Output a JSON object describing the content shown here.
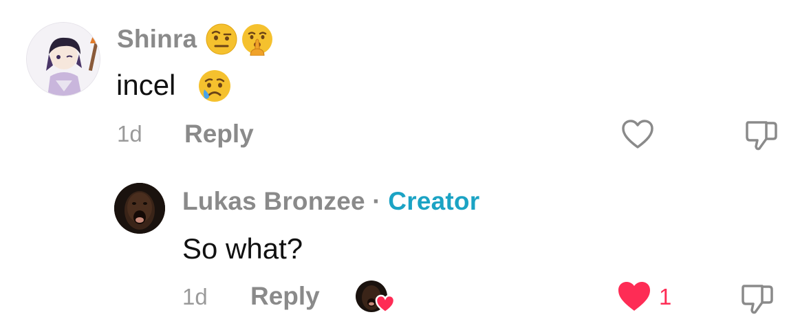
{
  "comment": {
    "username": "Shinra",
    "text": "incel",
    "time": "1d",
    "reply_label": "Reply",
    "emojis": [
      "raised-eyebrow-emoji",
      "shushing-face-emoji",
      "crying-face-emoji"
    ]
  },
  "reply": {
    "username": "Lukas Bronzee",
    "separator": "·",
    "badge": "Creator",
    "text": "So what?",
    "time": "1d",
    "reply_label": "Reply",
    "like_count": "1",
    "liked": true,
    "creator_liked": true
  },
  "colors": {
    "accent_creator": "#1ba3c4",
    "like_red": "#fe2c55",
    "muted_gray": "#8a8a8a"
  },
  "icons": [
    "heart-outline-icon",
    "dislike-icon",
    "heart-filled-icon",
    "creator-liked-badge"
  ]
}
